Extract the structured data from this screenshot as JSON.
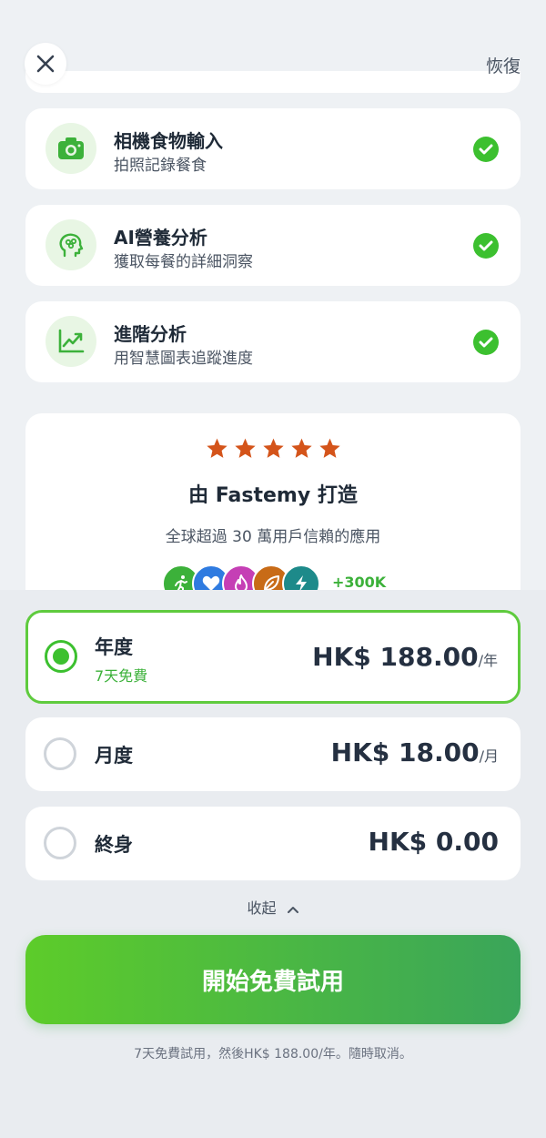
{
  "header": {
    "restore_label": "恢復"
  },
  "features": [
    {
      "title": "相機食物輸入",
      "subtitle": "拍照記錄餐食",
      "icon": "camera-icon"
    },
    {
      "title": "AI營養分析",
      "subtitle": "獲取每餐的詳細洞察",
      "icon": "brain-head-icon"
    },
    {
      "title": "進階分析",
      "subtitle": "用智慧圖表追蹤進度",
      "icon": "trend-chart-icon"
    }
  ],
  "social": {
    "rating": 5,
    "title": "由 Fastemy 打造",
    "subtitle": "全球超過 30 萬用戶信賴的應用",
    "user_count": "+300K",
    "avatar_icons": [
      "running-icon",
      "heart-icon",
      "flame-icon",
      "leaf-icon",
      "bolt-icon"
    ],
    "avatar_colors": [
      "#3cb13a",
      "#2f7be0",
      "#c53fb5",
      "#c86b17",
      "#1d8a8a"
    ]
  },
  "plans": [
    {
      "name": "年度",
      "trial": "7天免費",
      "price": "HK$ 188.00",
      "unit": "/年",
      "selected": true
    },
    {
      "name": "月度",
      "trial": "",
      "price": "HK$ 18.00",
      "unit": "/月",
      "selected": false
    },
    {
      "name": "終身",
      "trial": "",
      "price": "HK$ 0.00",
      "unit": "",
      "selected": false
    }
  ],
  "collapse_label": "收起",
  "cta_label": "開始免費試用",
  "fine_print": "7天免費試用，然後HK$ 188.00/年。隨時取消。",
  "colors": {
    "accent": "#3cc02f",
    "star": "#d4541a",
    "cta_start": "#5dcc2a",
    "cta_end": "#3aa55a"
  }
}
